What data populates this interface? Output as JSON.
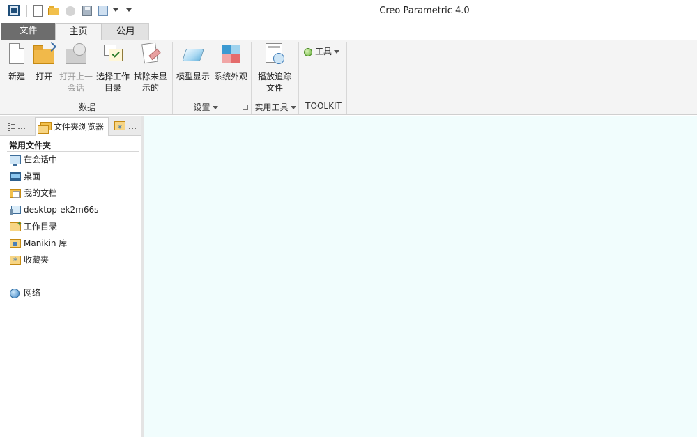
{
  "window": {
    "title": "Creo Parametric 4.0"
  },
  "quick_access": {
    "icons": [
      "app-menu-icon",
      "new-icon",
      "open-icon",
      "close-icon",
      "save-icon",
      "regenerate-icon",
      "dropdown-icon",
      "customize-icon"
    ]
  },
  "tabs": [
    {
      "label": "文件",
      "active": false
    },
    {
      "label": "主页",
      "active": true
    },
    {
      "label": "公用",
      "active": false
    }
  ],
  "ribbon": {
    "groups": {
      "data": "数据",
      "settings": "设置",
      "utilities": "实用工具",
      "toolkit": "TOOLKIT"
    },
    "commands": {
      "new": "新建",
      "open": "打开",
      "open_last_session": "打开上一\n会话",
      "select_working_dir": "选择工作\n目录",
      "erase_not_displayed": "拭除未显\n示的",
      "model_display": "模型显示",
      "system_appearance": "系统外观",
      "play_trail": "播放追踪\n文件",
      "tools": "工具"
    }
  },
  "left_panel": {
    "tabs": [
      {
        "label": "…",
        "icon": "model-tree-icon"
      },
      {
        "label": "文件夹浏览器",
        "icon": "folder-browser-icon"
      },
      {
        "label": "…",
        "icon": "favorites-icon"
      }
    ],
    "section_title": "常用文件夹",
    "items": [
      {
        "label": "在会话中",
        "icon": "in-session-icon"
      },
      {
        "label": "桌面",
        "icon": "desktop-icon"
      },
      {
        "label": "我的文档",
        "icon": "my-documents-icon"
      },
      {
        "label": "desktop-ek2m66s",
        "icon": "computer-icon"
      },
      {
        "label": "工作目录",
        "icon": "working-directory-icon"
      },
      {
        "label": "Manikin 库",
        "icon": "manikin-library-icon"
      },
      {
        "label": "收藏夹",
        "icon": "favorites-folder-icon"
      },
      {
        "label": "网络",
        "icon": "network-icon"
      }
    ]
  },
  "colors": {
    "graphics_background": "#f1fdfd",
    "ribbon_background": "#f4f4f4",
    "file_tab": "#6d6d6d"
  }
}
